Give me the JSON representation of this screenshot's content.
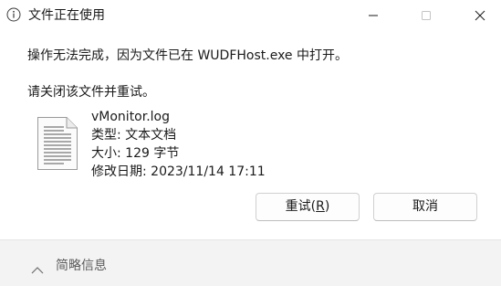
{
  "titlebar": {
    "title": "文件正在使用",
    "icon": "info-circle-icon",
    "minimize_icon": "minimize-icon",
    "maximize_icon": "maximize-icon",
    "close_icon": "close-icon"
  },
  "message": {
    "line1": "操作无法完成，因为文件已在 WUDFHost.exe 中打开。",
    "line2": "请关闭该文件并重试。"
  },
  "file": {
    "icon": "text-document-icon",
    "name": "vMonitor.log",
    "type": "类型: 文本文档",
    "size": "大小: 129 字节",
    "modified": "修改日期: 2023/11/14 17:11"
  },
  "buttons": {
    "retry_label": "重试(R)",
    "retry_mnemonic_prefix": "重试(",
    "retry_mnemonic_key": "R",
    "retry_mnemonic_suffix": ")",
    "cancel_label": "取消"
  },
  "footer": {
    "details_label": "简略信息",
    "icon": "chevron-up-icon"
  }
}
